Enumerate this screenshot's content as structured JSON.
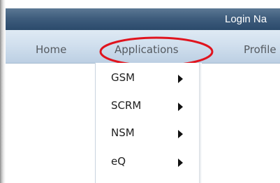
{
  "header": {
    "login_text": "Login Na"
  },
  "nav": {
    "items": [
      {
        "label": "Home"
      },
      {
        "label": "Applications"
      },
      {
        "label": "Profile"
      }
    ]
  },
  "dropdown": {
    "items": [
      {
        "label": "GSM"
      },
      {
        "label": "SCRM"
      },
      {
        "label": "NSM"
      },
      {
        "label": "eQ"
      }
    ]
  },
  "colors": {
    "header_bar": "#3f5d7d",
    "nav_bar": "#cfdeed",
    "highlight_ellipse": "#e0141e"
  },
  "icons": {
    "submenu_arrow": "triangle-right-icon"
  }
}
